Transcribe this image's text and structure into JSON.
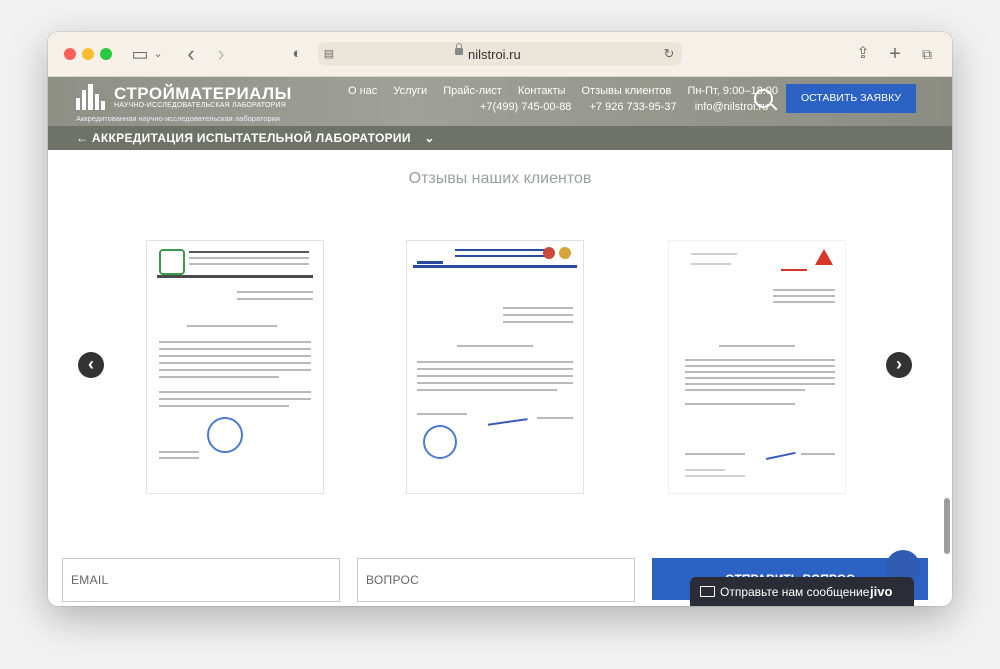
{
  "browser": {
    "url": "nilstroi.ru"
  },
  "header": {
    "brand_title": "СТРОЙМАТЕРИАЛЫ",
    "brand_subtitle": "НАУЧНО-ИССЛЕДОВАТЕЛЬСКАЯ ЛАБОРАТОРИЯ",
    "brand_desc": "Аккредитованная научно-исследовательская лаборатория",
    "nav": [
      "О нас",
      "Услуги",
      "Прайс-лист",
      "Контакты",
      "Отзывы клиентов",
      "Пн-Пт, 9:00–18:00"
    ],
    "phone1": "+7(499) 745-00-88",
    "phone2": "+7 926 733-95-37",
    "email": "info@nilstroi.ru",
    "cta_label": "ОСТАВИТЬ ЗАЯВКУ"
  },
  "subnav": {
    "label": "← АККРЕДИТАЦИЯ ИСПЫТАТЕЛЬНОЙ ЛАБОРАТОРИИ"
  },
  "reviews": {
    "title": "Отзывы наших клиентов"
  },
  "form": {
    "email_placeholder": "EMAIL",
    "question_placeholder": "ВОПРОС",
    "submit_label": "ОТПРАВИТЬ ВОПРОС"
  },
  "chat": {
    "message": "Отправьте нам сообщение",
    "brand": "jivo"
  },
  "colors": {
    "accent": "#2c62c4",
    "header_bg": "#9fa097",
    "subbar_bg": "#6f7269"
  }
}
